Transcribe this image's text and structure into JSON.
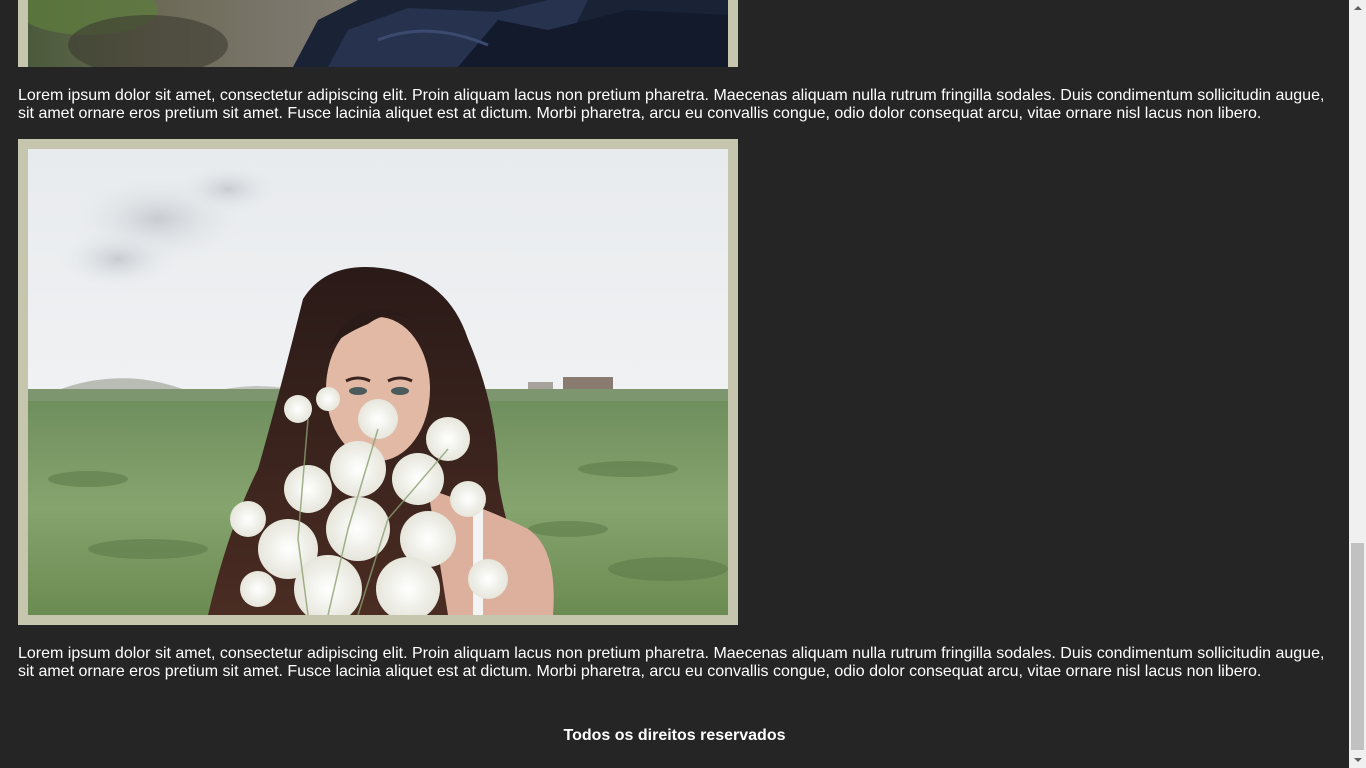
{
  "content": {
    "paragraph1": "Lorem ipsum dolor sit amet, consectetur adipiscing elit. Proin aliquam lacus non pretium pharetra. Maecenas aliquam nulla rutrum fringilla sodales. Duis condimentum sollicitudin augue, sit amet ornare eros pretium sit amet. Fusce lacinia aliquet est at dictum. Morbi pharetra, arcu eu convallis congue, odio dolor consequat arcu, vitae ornare nisl lacus non libero.",
    "paragraph2": "Lorem ipsum dolor sit amet, consectetur adipiscing elit. Proin aliquam lacus non pretium pharetra. Maecenas aliquam nulla rutrum fringilla sodales. Duis condimentum sollicitudin augue, sit amet ornare eros pretium sit amet. Fusce lacinia aliquet est at dictum. Morbi pharetra, arcu eu convallis congue, odio dolor consequat arcu, vitae ornare nisl lacus non libero."
  },
  "footer": {
    "text": "Todos os direitos reservados"
  },
  "colors": {
    "background": "#262526",
    "frame": "#c6c5ae",
    "text": "#ffffff"
  }
}
